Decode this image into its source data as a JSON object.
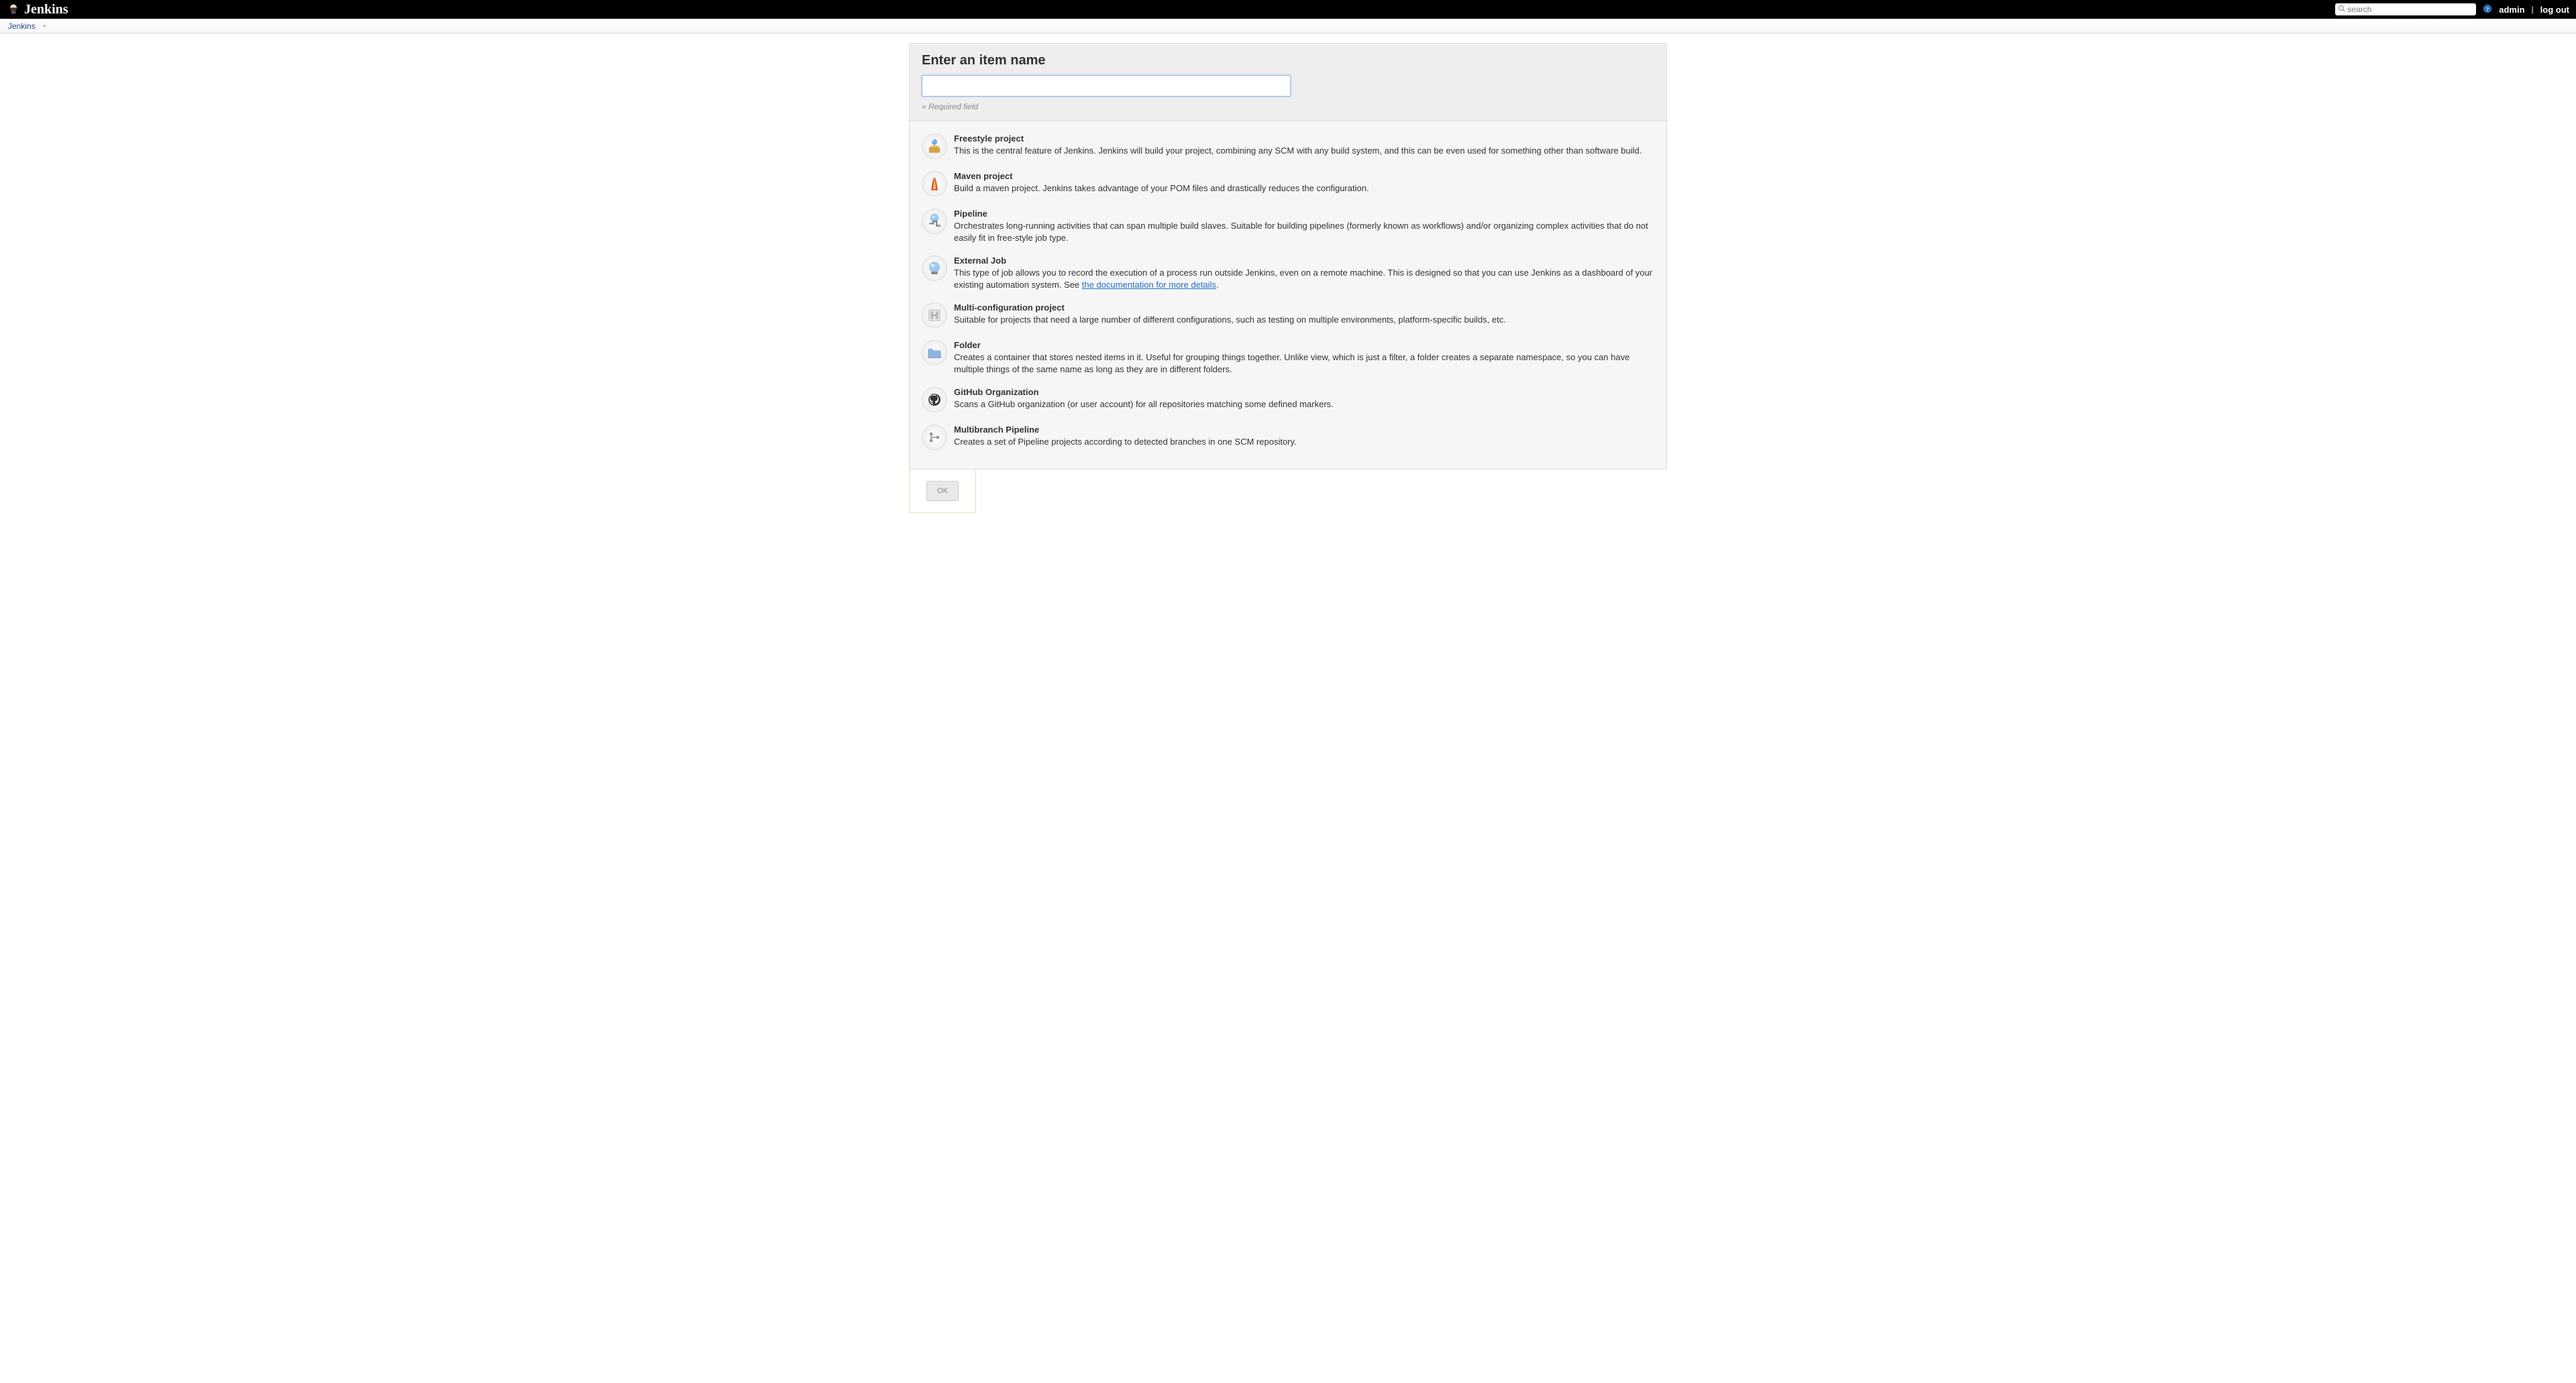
{
  "header": {
    "logo_text": "Jenkins",
    "search_placeholder": "search",
    "user_link": "admin",
    "logout_link": "log out"
  },
  "breadcrumb": {
    "root": "Jenkins"
  },
  "name_section": {
    "heading": "Enter an item name",
    "input_value": "",
    "required_note": "» Required field"
  },
  "types": [
    {
      "id": "freestyle",
      "title": "Freestyle project",
      "desc": "This is the central feature of Jenkins. Jenkins will build your project, combining any SCM with any build system, and this can be even used for something other than software build."
    },
    {
      "id": "maven",
      "title": "Maven project",
      "desc": "Build a maven project. Jenkins takes advantage of your POM files and drastically reduces the configuration."
    },
    {
      "id": "pipeline",
      "title": "Pipeline",
      "desc": "Orchestrates long-running activities that can span multiple build slaves. Suitable for building pipelines (formerly known as workflows) and/or organizing complex activities that do not easily fit in free-style job type."
    },
    {
      "id": "external",
      "title": "External Job",
      "desc_pre": "This type of job allows you to record the execution of a process run outside Jenkins, even on a remote machine. This is designed so that you can use Jenkins as a dashboard of your existing automation system. See ",
      "link_text": "the documentation for more details",
      "desc_post": "."
    },
    {
      "id": "multiconfig",
      "title": "Multi-configuration project",
      "desc": "Suitable for projects that need a large number of different configurations, such as testing on multiple environments, platform-specific builds, etc."
    },
    {
      "id": "folder",
      "title": "Folder",
      "desc": "Creates a container that stores nested items in it. Useful for grouping things together. Unlike view, which is just a filter, a folder creates a separate namespace, so you can have multiple things of the same name as long as they are in different folders."
    },
    {
      "id": "github-org",
      "title": "GitHub Organization",
      "desc": "Scans a GitHub organization (or user account) for all repositories matching some defined markers."
    },
    {
      "id": "multibranch",
      "title": "Multibranch Pipeline",
      "desc": "Creates a set of Pipeline projects according to detected branches in one SCM repository."
    }
  ],
  "ok_button": "OK"
}
